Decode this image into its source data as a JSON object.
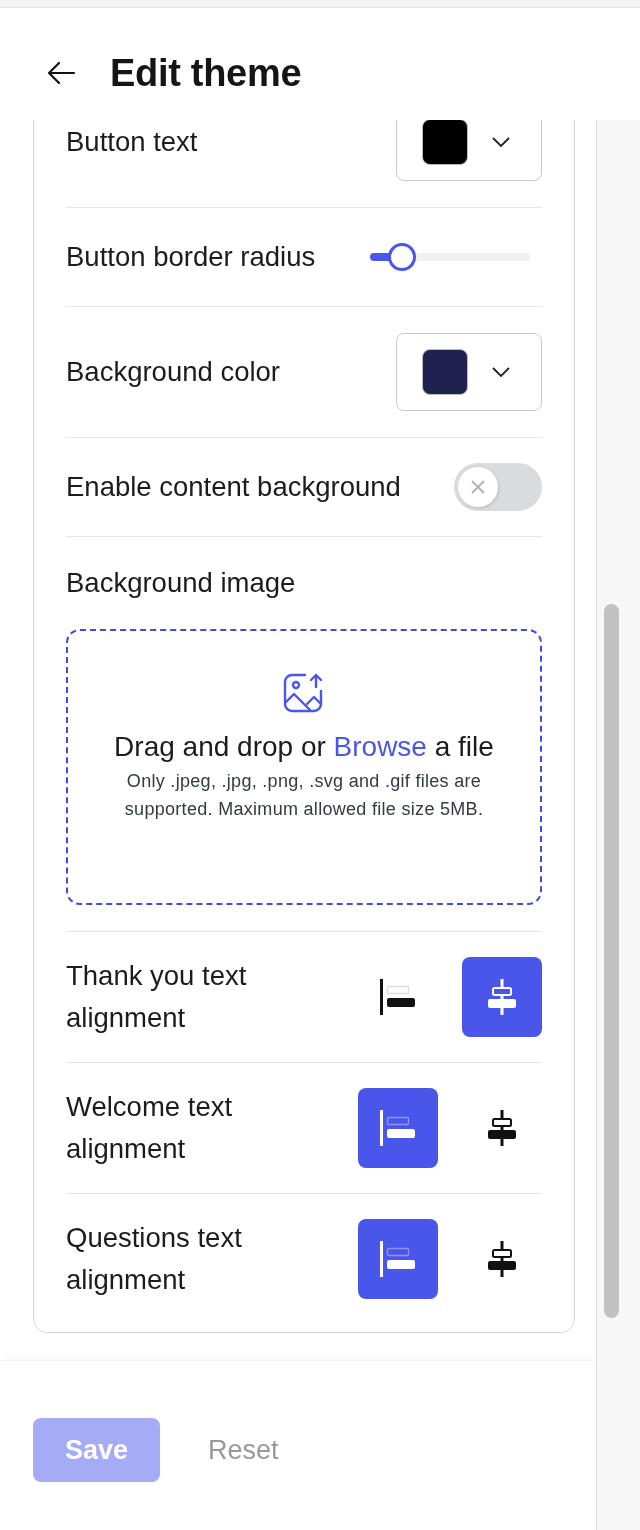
{
  "header": {
    "title": "Edit theme"
  },
  "settings": [
    {
      "kind": "color",
      "label": "Button text",
      "color": "#000000"
    },
    {
      "kind": "slider",
      "label": "Button border radius",
      "level": 0.2
    },
    {
      "kind": "color",
      "label": "Background color",
      "color": "#1f2150"
    },
    {
      "kind": "toggle",
      "label": "Enable content background",
      "on": false
    },
    {
      "kind": "upload",
      "label": "Background image",
      "prompt_start": "Drag and drop or ",
      "link": "Browse",
      "prompt_end": " a file",
      "hint": "Only .jpeg, .jpg, .png, .svg and .gif files are supported. Maximum allowed file size 5MB."
    },
    {
      "kind": "alignment",
      "label": "Thank you text alignment",
      "options": [
        {
          "kind": "left",
          "selected": false
        },
        {
          "kind": "center",
          "selected": true
        }
      ]
    },
    {
      "kind": "alignment",
      "label": "Welcome text alignment",
      "options": [
        {
          "kind": "left",
          "selected": true
        },
        {
          "kind": "center",
          "selected": false
        }
      ]
    },
    {
      "kind": "alignment",
      "label": "Questions text alignment",
      "options": [
        {
          "kind": "left",
          "selected": true
        },
        {
          "kind": "center",
          "selected": false
        }
      ]
    }
  ],
  "footer": {
    "buttons": [
      {
        "kind": "primary",
        "label": "Save",
        "disabled": true
      },
      {
        "kind": "text",
        "label": "Reset",
        "disabled": true
      }
    ]
  }
}
